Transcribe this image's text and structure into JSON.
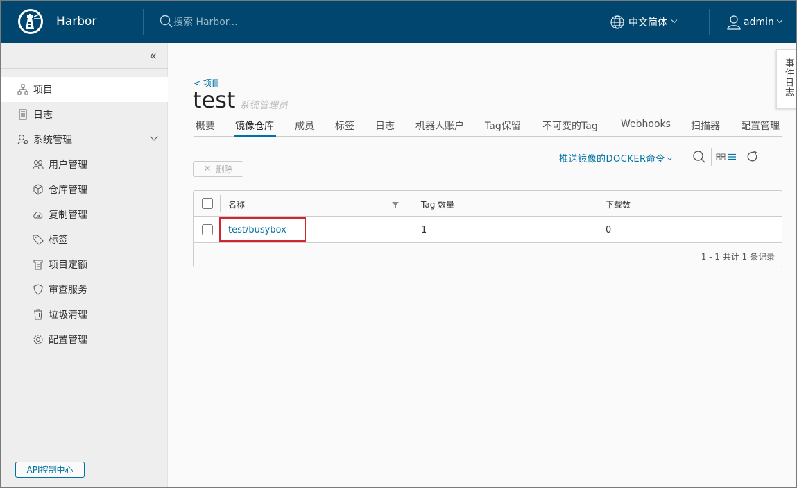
{
  "header": {
    "brand": "Harbor",
    "search_placeholder": "搜索 Harbor...",
    "language": "中文简体",
    "user": "admin"
  },
  "sidebar": {
    "items": [
      {
        "label": "项目",
        "icon": "projects-icon",
        "active": true
      },
      {
        "label": "日志",
        "icon": "logs-icon"
      },
      {
        "label": "系统管理",
        "icon": "admin-icon",
        "expanded": true
      }
    ],
    "sub_items": [
      {
        "label": "用户管理",
        "icon": "users-icon"
      },
      {
        "label": "仓库管理",
        "icon": "registry-icon"
      },
      {
        "label": "复制管理",
        "icon": "replication-icon"
      },
      {
        "label": "标签",
        "icon": "tag-icon"
      },
      {
        "label": "项目定额",
        "icon": "quota-icon"
      },
      {
        "label": "审查服务",
        "icon": "shield-icon"
      },
      {
        "label": "垃圾清理",
        "icon": "trash-icon"
      },
      {
        "label": "配置管理",
        "icon": "gear-icon"
      }
    ],
    "api_button": "API控制中心"
  },
  "main": {
    "breadcrumb": "< 项目",
    "title": "test",
    "role": "系统管理员",
    "tabs": [
      "概要",
      "镜像仓库",
      "成员",
      "标签",
      "日志",
      "机器人账户",
      "Tag保留",
      "不可变的Tag",
      "Webhooks",
      "扫描器",
      "配置管理"
    ],
    "active_tab": "镜像仓库",
    "push_command": "推送镜像的DOCKER命令",
    "delete_button": "删除",
    "table": {
      "columns": [
        "名称",
        "Tag 数量",
        "下载数"
      ],
      "rows": [
        {
          "name": "test/busybox",
          "tags": "1",
          "pulls": "0"
        }
      ],
      "footer": "1 - 1 共计 1 条记录"
    }
  },
  "event_log": "事件日志",
  "colors": {
    "header_bg": "#00466e",
    "accent": "#0072a3",
    "highlight": "#d0262d"
  }
}
